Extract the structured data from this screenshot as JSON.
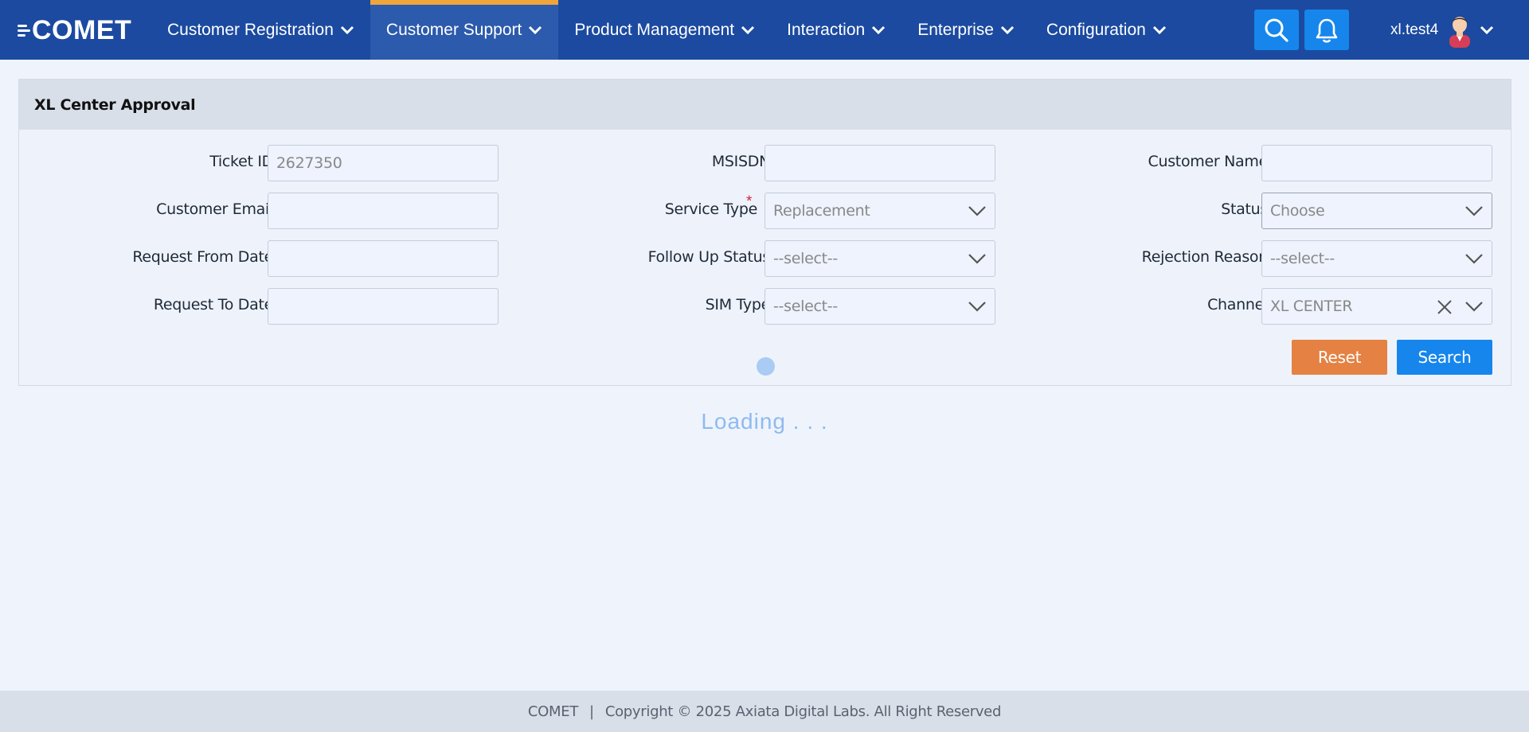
{
  "app": {
    "logo_text": "COMET"
  },
  "nav": {
    "items": [
      {
        "label": "Customer Registration",
        "active": false
      },
      {
        "label": "Customer Support",
        "active": true
      },
      {
        "label": "Product Management",
        "active": false
      },
      {
        "label": "Interaction",
        "active": false
      },
      {
        "label": "Enterprise",
        "active": false
      },
      {
        "label": "Configuration",
        "active": false
      }
    ],
    "username": "xl.test4",
    "accent_color": "#f0a53c",
    "bar_color": "#1b4aa0"
  },
  "panel": {
    "title": "XL Center Approval",
    "fields": {
      "ticket_id": {
        "label": "Ticket ID",
        "value": "2627350"
      },
      "msisdn": {
        "label": "MSISDN",
        "value": ""
      },
      "customer_name": {
        "label": "Customer Name",
        "value": ""
      },
      "customer_email": {
        "label": "Customer Email",
        "value": ""
      },
      "service_type": {
        "label": "Service Type",
        "required_mark": "*",
        "value": "Replacement"
      },
      "status": {
        "label": "Status",
        "value": "Choose"
      },
      "request_from_date": {
        "label": "Request From Date",
        "value": ""
      },
      "follow_up_status": {
        "label": "Follow Up Status",
        "value": "--select--"
      },
      "rejection_reason": {
        "label": "Rejection Reason",
        "value": "--select--"
      },
      "request_to_date": {
        "label": "Request To Date",
        "value": ""
      },
      "sim_type": {
        "label": "SIM Type",
        "value": "--select--"
      },
      "channel": {
        "label": "Channel",
        "value": "XL CENTER"
      }
    },
    "buttons": {
      "reset": "Reset",
      "search": "Search"
    }
  },
  "loading_text": "Loading . . .",
  "footer": {
    "brand": "COMET",
    "separator": "|",
    "copyright": "Copyright © 2025 Axiata Digital Labs. All Right Reserved"
  }
}
